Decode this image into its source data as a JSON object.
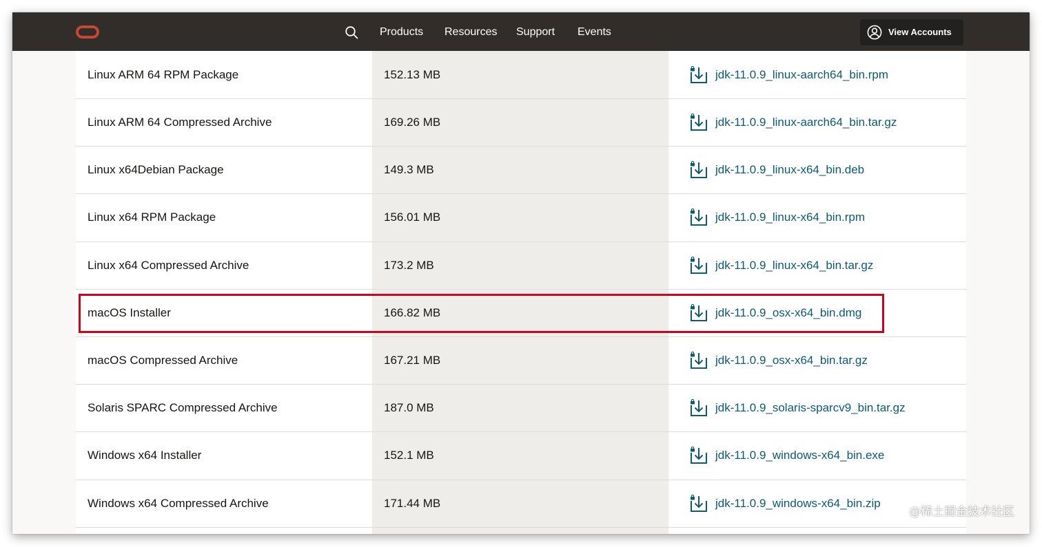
{
  "navbar": {
    "logo": "oracle-logo",
    "items": [
      {
        "label": "Products"
      },
      {
        "label": "Resources"
      },
      {
        "label": "Support"
      },
      {
        "label": "Events"
      }
    ],
    "account_button": "View Accounts"
  },
  "downloads": {
    "rows": [
      {
        "name": "Linux ARM 64 RPM Package",
        "size": "152.13 MB",
        "file": "jdk-11.0.9_linux-aarch64_bin.rpm"
      },
      {
        "name": "Linux ARM 64 Compressed Archive",
        "size": "169.26 MB",
        "file": "jdk-11.0.9_linux-aarch64_bin.tar.gz"
      },
      {
        "name": "Linux x64Debian Package",
        "size": "149.3 MB",
        "file": "jdk-11.0.9_linux-x64_bin.deb"
      },
      {
        "name": "Linux x64 RPM Package",
        "size": "156.01 MB",
        "file": "jdk-11.0.9_linux-x64_bin.rpm"
      },
      {
        "name": "Linux x64 Compressed Archive",
        "size": "173.2 MB",
        "file": "jdk-11.0.9_linux-x64_bin.tar.gz"
      },
      {
        "name": "macOS Installer",
        "size": "166.82 MB",
        "file": "jdk-11.0.9_osx-x64_bin.dmg"
      },
      {
        "name": "macOS Compressed Archive",
        "size": "167.21 MB",
        "file": "jdk-11.0.9_osx-x64_bin.tar.gz"
      },
      {
        "name": "Solaris SPARC Compressed Archive",
        "size": "187.0 MB",
        "file": "jdk-11.0.9_solaris-sparcv9_bin.tar.gz"
      },
      {
        "name": "Windows x64 Installer",
        "size": "152.1 MB",
        "file": "jdk-11.0.9_windows-x64_bin.exe"
      },
      {
        "name": "Windows x64 Compressed Archive",
        "size": "171.44 MB",
        "file": "jdk-11.0.9_windows-x64_bin.zip"
      }
    ]
  },
  "highlight_color": "#d0021b",
  "link_color": "#0b5a78",
  "watermark": "@稀土掘金技术社区"
}
